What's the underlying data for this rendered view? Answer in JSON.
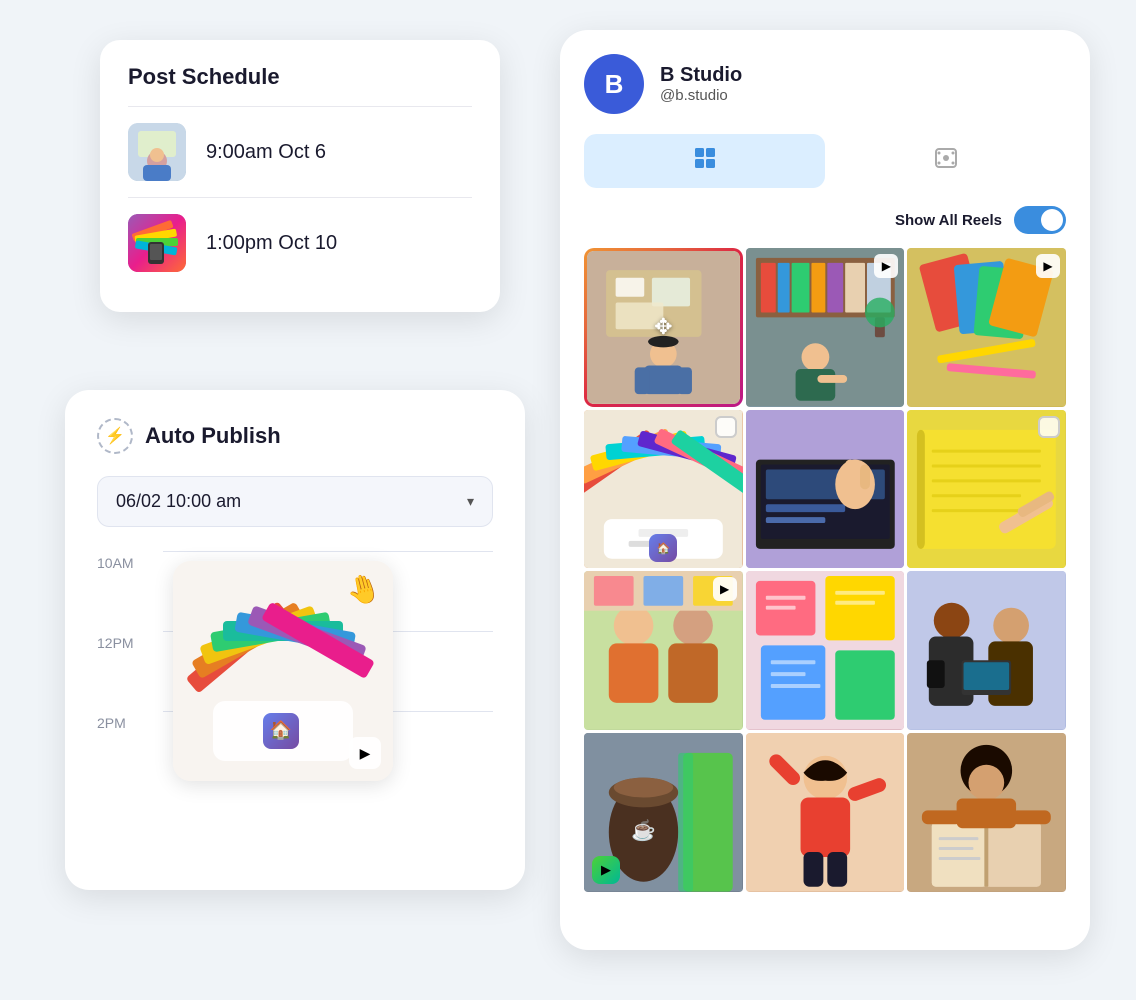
{
  "postSchedule": {
    "title": "Post Schedule",
    "items": [
      {
        "time": "9:00am Oct 6",
        "thumbType": "person"
      },
      {
        "time": "1:00pm Oct 10",
        "thumbType": "colorful"
      }
    ]
  },
  "autoPublish": {
    "title": "Auto Publish",
    "dateValue": "06/02  10:00 am",
    "timeLabels": [
      "10AM",
      "12PM",
      "2PM"
    ]
  },
  "bStudio": {
    "name": "B Studio",
    "handle": "@b.studio",
    "avatarLetter": "B",
    "tabs": [
      {
        "icon": "⊞",
        "active": true
      },
      {
        "icon": "▶",
        "active": false
      }
    ],
    "reelsLabel": "Show All Reels",
    "toggleOn": true
  }
}
